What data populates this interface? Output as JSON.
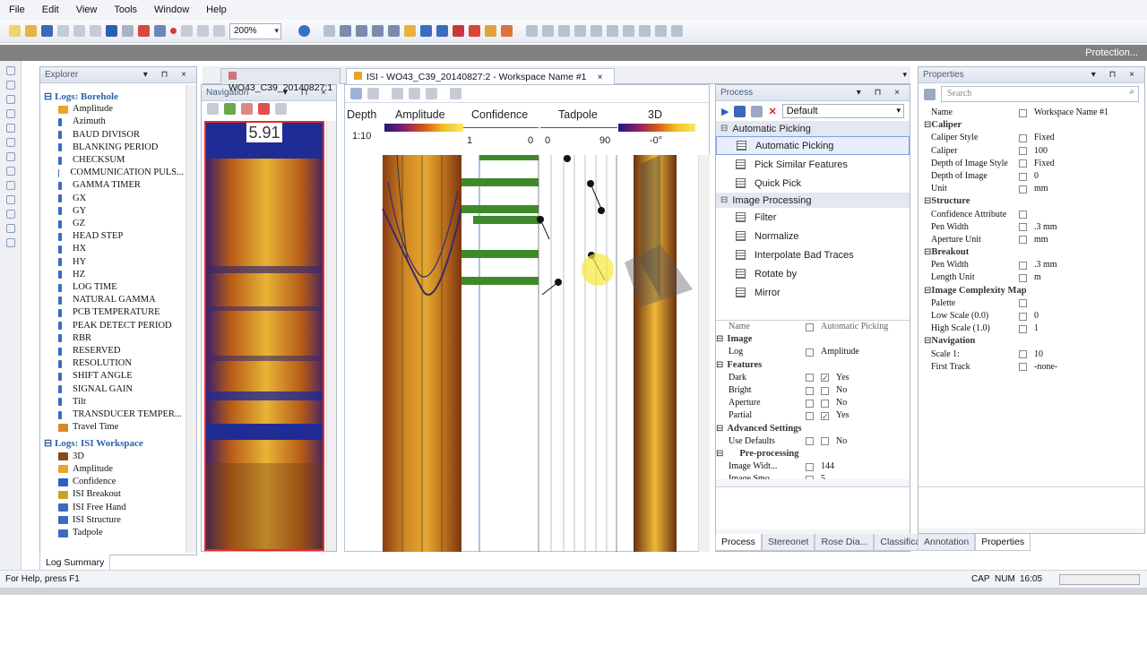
{
  "menu": [
    "File",
    "Edit",
    "View",
    "Tools",
    "Window",
    "Help"
  ],
  "toolbar": {
    "zoom": "200%"
  },
  "protection": "Protection...",
  "explorer": {
    "title": "Explorer",
    "borehole_group": "Logs: Borehole",
    "borehole_items": [
      "Amplitude",
      "Azimuth",
      "BAUD DIVISOR",
      "BLANKING PERIOD",
      "CHECKSUM",
      "COMMUNICATION PULS...",
      "GAMMA TIMER",
      "GX",
      "GY",
      "GZ",
      "HEAD STEP",
      "HX",
      "HY",
      "HZ",
      "LOG TIME",
      "NATURAL GAMMA",
      "PCB TEMPERATURE",
      "PEAK DETECT PERIOD",
      "RBR",
      "RESERVED",
      "RESOLUTION",
      "SHIFT ANGLE",
      "SIGNAL GAIN",
      "Tilt",
      "TRANSDUCER TEMPER...",
      "Travel Time"
    ],
    "isi_group": "Logs: ISI Workspace",
    "isi_items": [
      "3D",
      "Amplitude",
      "Confidence",
      "ISI Breakout",
      "ISI Free Hand",
      "ISI Structure",
      "Tadpole"
    ],
    "tab": "Log Summary"
  },
  "navigation": {
    "title": "Navigation",
    "value": "5.91"
  },
  "doc_tabs": [
    "WO43_C39_20140827:1",
    "ISI - WO43_C39_20140827:2 - Workspace Name #1"
  ],
  "legend": {
    "depth": "Depth",
    "scale": "1:10",
    "amplitude": "Amplitude",
    "confidence": "Confidence",
    "conf_min": "1",
    "conf_max": "0",
    "tadpole": "Tadpole",
    "tad_min": "0",
    "tad_max": "90",
    "three_d": "3D",
    "three_d_val": "-0°"
  },
  "process": {
    "title": "Process",
    "preset": "Default",
    "auto_group": "Automatic Picking",
    "auto_items": [
      "Automatic Picking",
      "Pick Similar Features",
      "Quick Pick"
    ],
    "img_group": "Image Processing",
    "img_items": [
      "Filter",
      "Normalize",
      "Interpolate Bad Traces",
      "Rotate by",
      "Mirror"
    ],
    "props": [
      {
        "k": "Name",
        "v": "Automatic Picking",
        "t": "top"
      },
      {
        "k": "Image",
        "t": "sec"
      },
      {
        "k": "Log",
        "v": "Amplitude"
      },
      {
        "k": "Features",
        "t": "sec"
      },
      {
        "k": "Dark",
        "v": "Yes",
        "c": true
      },
      {
        "k": "Bright",
        "v": "No",
        "c": false
      },
      {
        "k": "Aperture",
        "v": "No",
        "c": false
      },
      {
        "k": "Partial",
        "v": "Yes",
        "c": true
      },
      {
        "k": "Advanced Settings",
        "t": "sec"
      },
      {
        "k": "Use Defaults",
        "v": "No",
        "c": false
      },
      {
        "k": "Pre-processing",
        "t": "sub"
      },
      {
        "k": "Image Widt...",
        "v": "144"
      },
      {
        "k": "Image Smo...",
        "v": "5"
      }
    ],
    "tabs": [
      "Process",
      "Stereonet",
      "Rose Dia...",
      "Classifica..."
    ]
  },
  "properties": {
    "title": "Properties",
    "search": "Search",
    "rows": [
      {
        "k": "Name",
        "v": "Workspace Name #1"
      },
      {
        "k": "Caliper",
        "t": "sec"
      },
      {
        "k": "Caliper Style",
        "v": "Fixed"
      },
      {
        "k": "Caliper",
        "v": "100"
      },
      {
        "k": "Depth of Image Style",
        "v": "Fixed"
      },
      {
        "k": "Depth of Image",
        "v": "0"
      },
      {
        "k": "Unit",
        "v": "mm"
      },
      {
        "k": "Structure",
        "t": "sec"
      },
      {
        "k": "Confidence Attribute",
        "v": ""
      },
      {
        "k": "Pen Width",
        "v": ".3 mm"
      },
      {
        "k": "Aperture Unit",
        "v": "mm"
      },
      {
        "k": "Breakout",
        "t": "sec"
      },
      {
        "k": "Pen Width",
        "v": ".3 mm"
      },
      {
        "k": "Length Unit",
        "v": "m"
      },
      {
        "k": "Image Complexity Map",
        "t": "sec"
      },
      {
        "k": "Palette",
        "v": ""
      },
      {
        "k": "Low Scale (0.0)",
        "v": "0"
      },
      {
        "k": "High Scale (1.0)",
        "v": "1"
      },
      {
        "k": "Navigation",
        "t": "sec"
      },
      {
        "k": "Scale 1:",
        "v": "10"
      },
      {
        "k": "First Track",
        "v": "-none-"
      }
    ],
    "tabs": [
      "Annotation",
      "Properties"
    ]
  },
  "status": {
    "help": "For Help, press F1",
    "cap": "CAP",
    "num": "NUM",
    "time": "16:05"
  }
}
